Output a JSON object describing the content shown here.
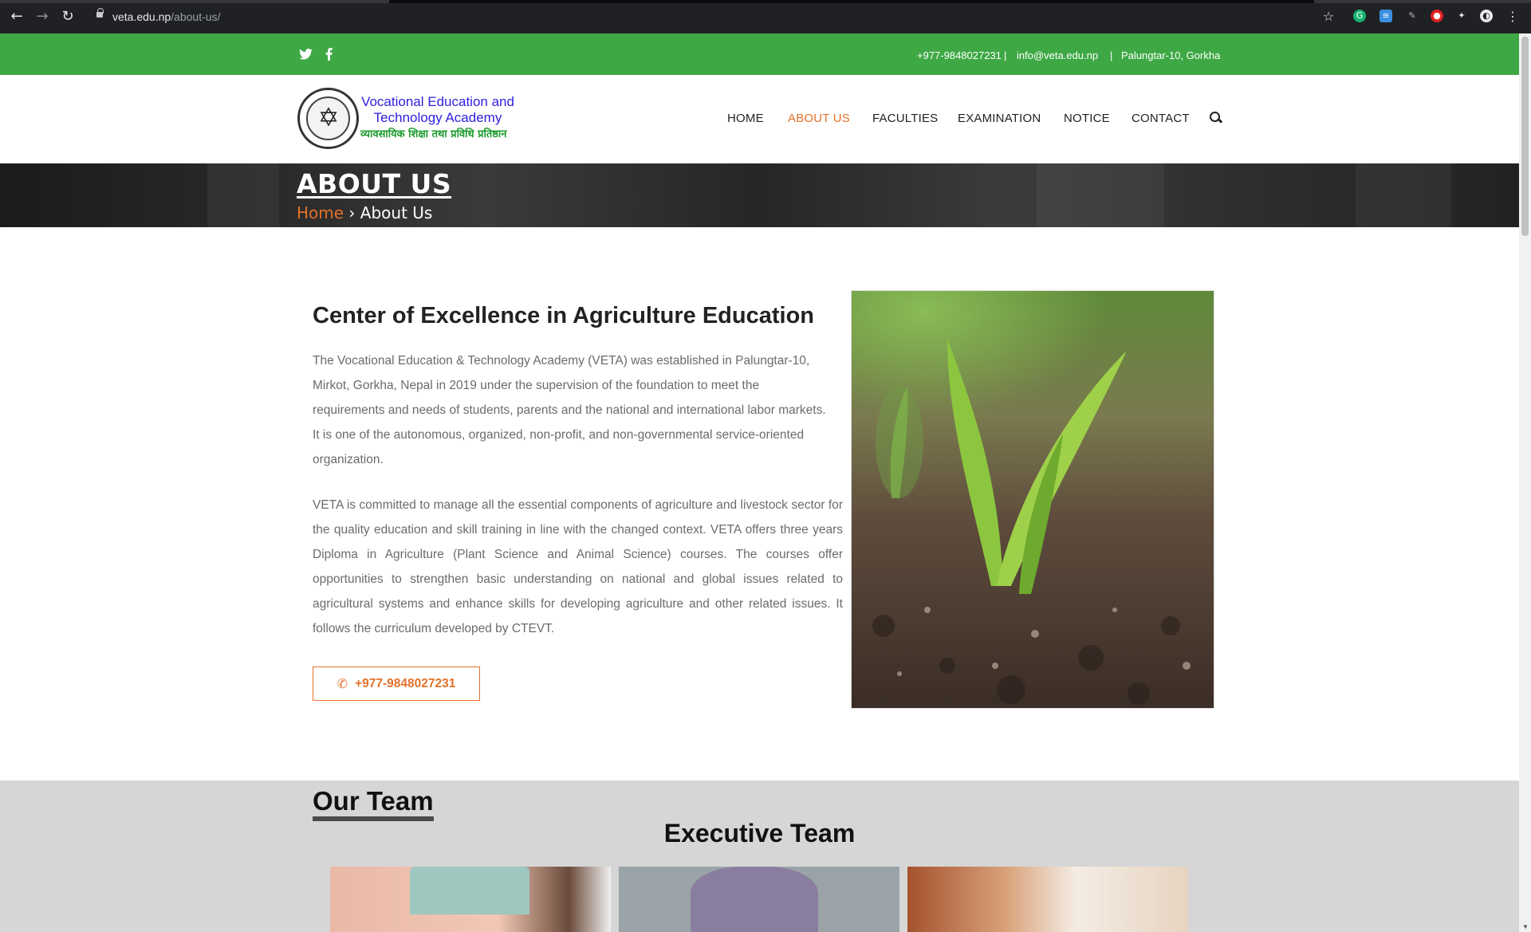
{
  "browser": {
    "url_host": "veta.edu.np",
    "url_path": "/about-us/"
  },
  "topbar": {
    "phone": "+977-9848027231",
    "email": "info@veta.edu.np",
    "address": "Palungtar-10, Gorkha",
    "separator": "|"
  },
  "logo": {
    "title": "Vocational Education and Technology Academy",
    "subtitle": "व्यावसायिक शिक्षा तथा प्रविधि प्रतिष्ठान"
  },
  "nav": {
    "home": "HOME",
    "about": "ABOUT US",
    "faculties": "FACULTIES",
    "examination": "EXAMINATION",
    "notice": "NOTICE",
    "contact": "CONTACT"
  },
  "banner": {
    "title": "ABOUT US",
    "crumb_home": "Home",
    "crumb_sep": "›",
    "crumb_current": "About Us"
  },
  "about": {
    "heading": "Center of Excellence in Agriculture Education",
    "para1": "The Vocational Education & Technology Academy (VETA) was established in Palungtar-10, Mirkot, Gorkha, Nepal in 2019 under the supervision of the foundation to meet the requirements and needs of students, parents and the national and international labor markets. It is one of the autonomous, organized, non-profit, and non-governmental service-oriented organization.",
    "para2": "VETA is committed to manage all the essential components of agriculture and livestock sector for the quality education and skill training in line with the changed context. VETA offers three years Diploma in Agriculture (Plant Science and Animal Science) courses. The courses offer opportunities to strengthen basic understanding on national and global issues related to agricultural systems and enhance skills for developing agriculture and other related issues. It follows the curriculum developed by CTEVT.",
    "call_label": "+977-9848027231"
  },
  "team": {
    "title": "Our Team",
    "subtitle": "Executive Team"
  },
  "colors": {
    "green": "#3ea844",
    "accent": "#e4712a",
    "team_bg": "#d6d6d6"
  },
  "icons": [
    "back-icon",
    "forward-icon",
    "reload-icon",
    "lock-icon",
    "star-icon",
    "twitter-icon",
    "facebook-icon",
    "search-icon",
    "phone-icon"
  ]
}
